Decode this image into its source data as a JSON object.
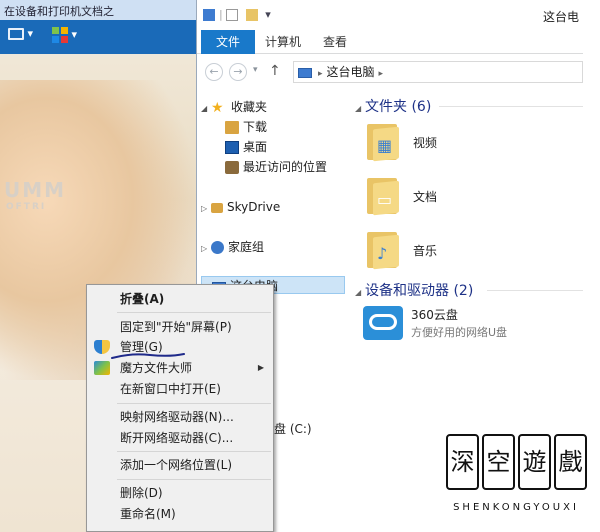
{
  "background_window": {
    "title": "在设备和打印机文档之",
    "brand_text": "UMM",
    "brand_sub": "OFTRI"
  },
  "explorer": {
    "window_title": "这台电",
    "ribbon_tabs": [
      "文件",
      "计算机",
      "查看"
    ],
    "address": {
      "location": "这台电脑"
    },
    "nav_pane": {
      "favorites": "收藏夹",
      "favorites_items": [
        "下载",
        "桌面",
        "最近访问的位置"
      ],
      "skydrive": "SkyDrive",
      "homegroup": "家庭组",
      "this_pc": "这台电脑"
    },
    "content": {
      "folders_group": "文件夹 (6)",
      "folders": [
        {
          "name": "视频",
          "icon": "film-icon"
        },
        {
          "name": "文档",
          "icon": "document-icon"
        },
        {
          "name": "音乐",
          "icon": "music-note-icon"
        }
      ],
      "devices_group": "设备和驱动器 (2)",
      "cloud_drive": {
        "name": "360云盘",
        "description": "方便好用的网络U盘"
      },
      "drive_c": "盘 (C:)"
    }
  },
  "context_menu": {
    "items": {
      "collapse": "折叠(A)",
      "pin_start": "固定到\"开始\"屏幕(P)",
      "manage": "管理(G)",
      "mofang": "魔方文件大师",
      "open_new_window": "在新窗口中打开(E)",
      "map_drive": "映射网络驱动器(N)...",
      "disconnect_drive": "断开网络驱动器(C)...",
      "add_network_location": "添加一个网络位置(L)",
      "delete": "删除(D)",
      "rename": "重命名(M)"
    }
  },
  "watermark": {
    "chars": [
      "深",
      "空",
      "遊",
      "戲"
    ],
    "latin": "SHENKONGYOUXI"
  },
  "colors": {
    "ribbon_file_tab": "#1979ca",
    "selection_bg": "#cde4f7",
    "group_header": "#1e3287",
    "annotation_underline": "#1f2a8a"
  }
}
